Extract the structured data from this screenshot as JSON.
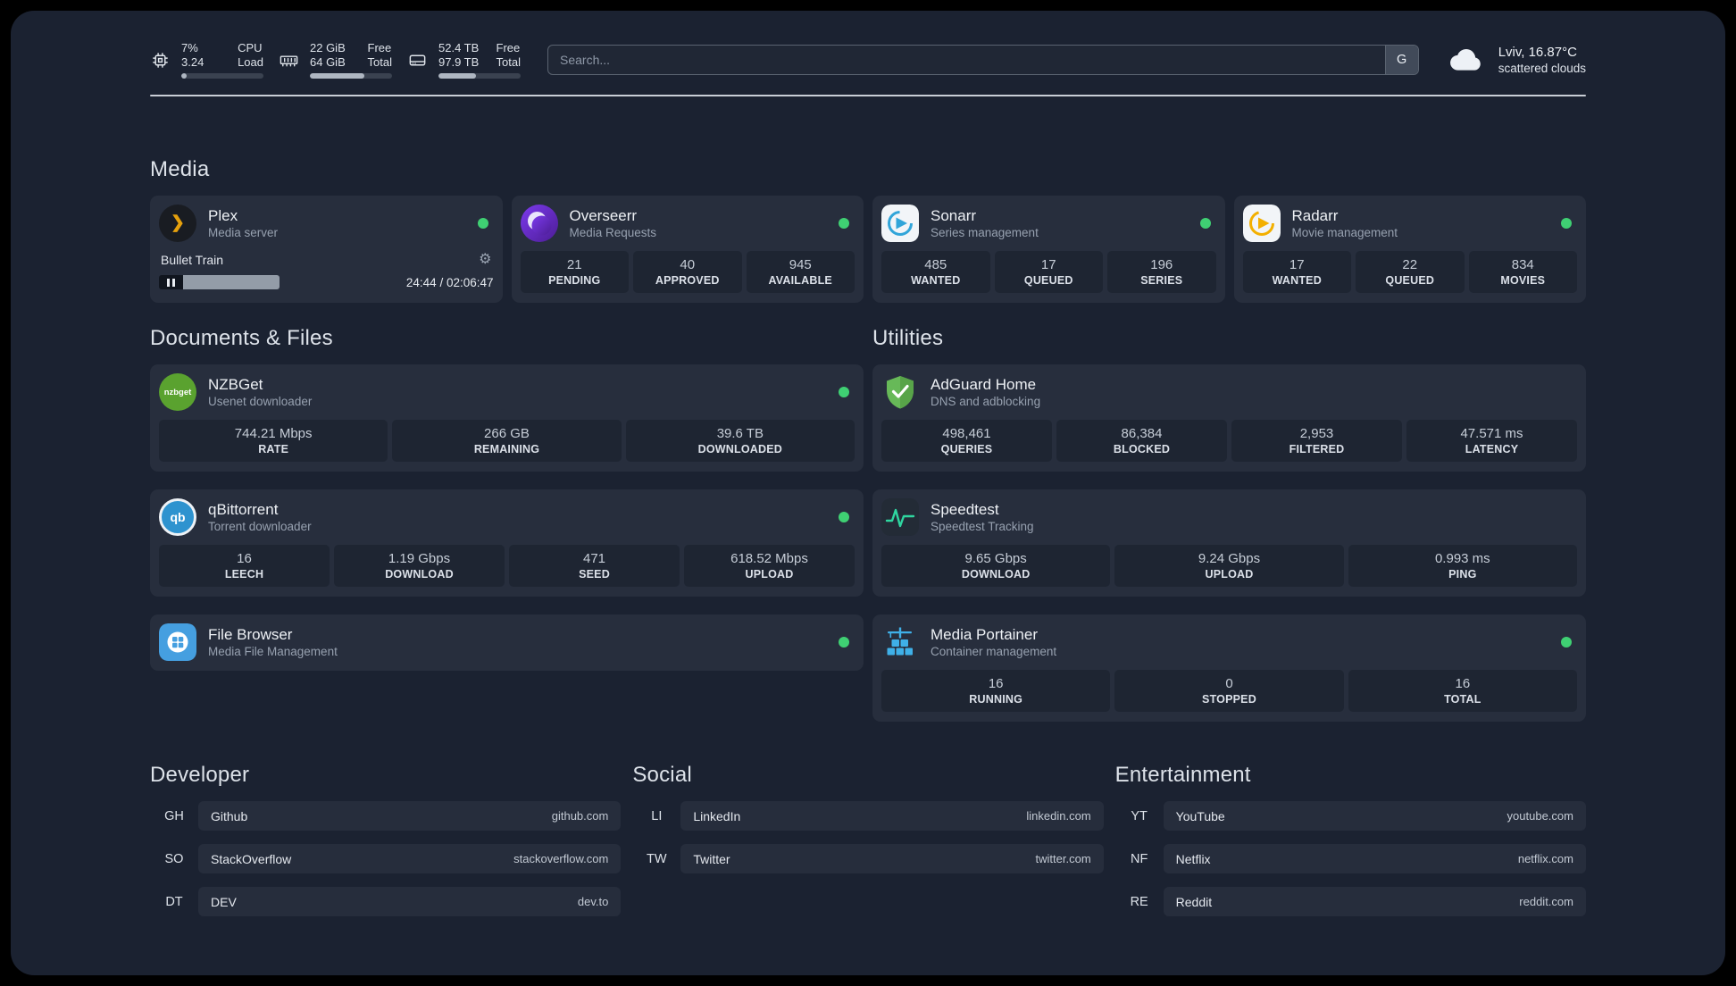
{
  "header": {
    "cpu": {
      "value1": "7%",
      "value2": "3.24",
      "label1": "CPU",
      "label2": "Load",
      "percent": 7
    },
    "memory": {
      "value1": "22 GiB",
      "value2": "64 GiB",
      "label1": "Free",
      "label2": "Total",
      "percent": 66
    },
    "disk": {
      "value1": "52.4 TB",
      "value2": "97.9 TB",
      "label1": "Free",
      "label2": "Total",
      "percent": 46
    },
    "search": {
      "placeholder": "Search...",
      "provider": "G"
    },
    "weather": {
      "location": "Lviv, 16.87°C",
      "condition": "scattered clouds"
    }
  },
  "groups": {
    "media": {
      "title": "Media",
      "plex": {
        "name": "Plex",
        "desc": "Media server",
        "icon_glyph": "❯",
        "gear_glyph": "⚙",
        "now_playing": "Bullet Train",
        "time": "24:44 / 02:06:47"
      },
      "overseerr": {
        "name": "Overseerr",
        "desc": "Media Requests",
        "stats": [
          {
            "value": "21",
            "label": "PENDING"
          },
          {
            "value": "40",
            "label": "APPROVED"
          },
          {
            "value": "945",
            "label": "AVAILABLE"
          }
        ]
      },
      "sonarr": {
        "name": "Sonarr",
        "desc": "Series management",
        "stats": [
          {
            "value": "485",
            "label": "WANTED"
          },
          {
            "value": "17",
            "label": "QUEUED"
          },
          {
            "value": "196",
            "label": "SERIES"
          }
        ]
      },
      "radarr": {
        "name": "Radarr",
        "desc": "Movie management",
        "stats": [
          {
            "value": "17",
            "label": "WANTED"
          },
          {
            "value": "22",
            "label": "QUEUED"
          },
          {
            "value": "834",
            "label": "MOVIES"
          }
        ]
      }
    },
    "documents": {
      "title": "Documents & Files",
      "nzbget": {
        "name": "NZBGet",
        "desc": "Usenet downloader",
        "icon_label": "nzbget",
        "stats": [
          {
            "value": "744.21 Mbps",
            "label": "RATE"
          },
          {
            "value": "266 GB",
            "label": "REMAINING"
          },
          {
            "value": "39.6 TB",
            "label": "DOWNLOADED"
          }
        ]
      },
      "qbittorrent": {
        "name": "qBittorrent",
        "desc": "Torrent downloader",
        "icon_label": "qb",
        "stats": [
          {
            "value": "16",
            "label": "LEECH"
          },
          {
            "value": "1.19 Gbps",
            "label": "DOWNLOAD"
          },
          {
            "value": "471",
            "label": "SEED"
          },
          {
            "value": "618.52 Mbps",
            "label": "UPLOAD"
          }
        ]
      },
      "filebrowser": {
        "name": "File Browser",
        "desc": "Media File Management"
      }
    },
    "utilities": {
      "title": "Utilities",
      "adguard": {
        "name": "AdGuard Home",
        "desc": "DNS and adblocking",
        "stats": [
          {
            "value": "498,461",
            "label": "QUERIES"
          },
          {
            "value": "86,384",
            "label": "BLOCKED"
          },
          {
            "value": "2,953",
            "label": "FILTERED"
          },
          {
            "value": "47.571 ms",
            "label": "LATENCY"
          }
        ]
      },
      "speedtest": {
        "name": "Speedtest",
        "desc": "Speedtest Tracking",
        "stats": [
          {
            "value": "9.65 Gbps",
            "label": "DOWNLOAD"
          },
          {
            "value": "9.24 Gbps",
            "label": "UPLOAD"
          },
          {
            "value": "0.993 ms",
            "label": "PING"
          }
        ]
      },
      "portainer": {
        "name": "Media Portainer",
        "desc": "Container management",
        "stats": [
          {
            "value": "16",
            "label": "RUNNING"
          },
          {
            "value": "0",
            "label": "STOPPED"
          },
          {
            "value": "16",
            "label": "TOTAL"
          }
        ]
      }
    }
  },
  "bookmarks": {
    "developer": {
      "title": "Developer",
      "items": [
        {
          "abbr": "GH",
          "name": "Github",
          "url": "github.com"
        },
        {
          "abbr": "SO",
          "name": "StackOverflow",
          "url": "stackoverflow.com"
        },
        {
          "abbr": "DT",
          "name": "DEV",
          "url": "dev.to"
        }
      ]
    },
    "social": {
      "title": "Social",
      "items": [
        {
          "abbr": "LI",
          "name": "LinkedIn",
          "url": "linkedin.com"
        },
        {
          "abbr": "TW",
          "name": "Twitter",
          "url": "twitter.com"
        }
      ]
    },
    "entertainment": {
      "title": "Entertainment",
      "items": [
        {
          "abbr": "YT",
          "name": "YouTube",
          "url": "youtube.com"
        },
        {
          "abbr": "NF",
          "name": "Netflix",
          "url": "netflix.com"
        },
        {
          "abbr": "RE",
          "name": "Reddit",
          "url": "reddit.com"
        }
      ]
    }
  },
  "colors": {
    "status_online": "#3fd073",
    "accent_plex": "#e5a00d"
  }
}
